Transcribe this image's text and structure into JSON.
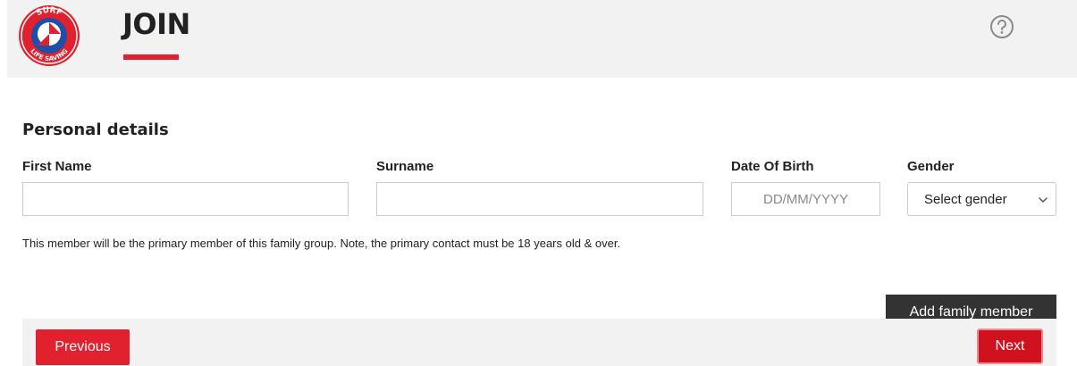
{
  "header": {
    "logo_text_top": "SURF",
    "logo_text_bottom": "LIFE SAVING",
    "title": "JOIN",
    "accent_color": "#e2212f"
  },
  "form": {
    "section_title": "Personal details",
    "first_name": {
      "label": "First Name",
      "value": "",
      "placeholder": ""
    },
    "surname": {
      "label": "Surname",
      "value": "",
      "placeholder": ""
    },
    "dob": {
      "label": "Date Of Birth",
      "value": "",
      "placeholder": "DD/MM/YYYY"
    },
    "gender": {
      "label": "Gender",
      "selected": "Select gender"
    },
    "note": "This member will be the primary member of this family group. Note, the primary contact must be 18 years old & over.",
    "add_member_label": "Add family member"
  },
  "footer": {
    "previous_label": "Previous",
    "next_label": "Next"
  },
  "icons": {
    "help": "help-circle-icon",
    "gender_dropdown": "chevron-down-icon"
  }
}
